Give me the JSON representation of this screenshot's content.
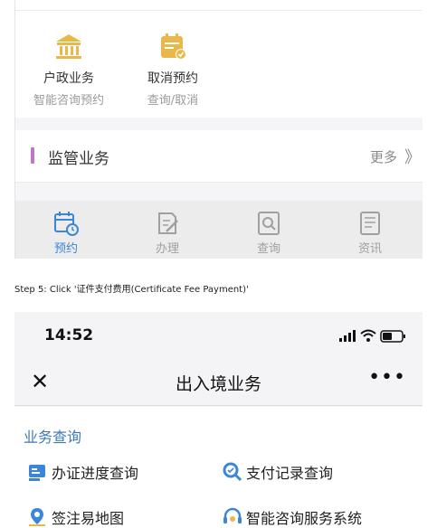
{
  "top_screen": {
    "services": [
      {
        "title": "户政业务",
        "subtitle": "智能咨询预约",
        "icon": "bank-icon"
      },
      {
        "title": "取消预约",
        "subtitle": "查询/取消",
        "icon": "calendar-check-icon"
      }
    ],
    "section": {
      "title": "监管业务",
      "more": "更多",
      "more_chevron": "》"
    },
    "tabs": [
      {
        "label": "预约",
        "icon": "calendar-clock-icon",
        "active": true
      },
      {
        "label": "办理",
        "icon": "edit-doc-icon",
        "active": false
      },
      {
        "label": "查询",
        "icon": "search-doc-icon",
        "active": false
      },
      {
        "label": "资讯",
        "icon": "news-icon",
        "active": false
      }
    ]
  },
  "step_caption": "Step 5: Click '证件支付费用(Certificate Fee Payment)'",
  "bottom_screen": {
    "status_bar": {
      "time": "14:52"
    },
    "nav": {
      "title": "出入境业务",
      "close_icon": "close-icon",
      "more_icon": "more-dots-icon",
      "close_glyph": "✕",
      "more_glyph": "•••"
    },
    "section_title": "业务查询",
    "items": [
      {
        "label": "办证进度查询",
        "icon": "id-card-icon"
      },
      {
        "label": "支付记录查询",
        "icon": "search-icon"
      },
      {
        "label": "签注易地图",
        "icon": "map-pin-icon"
      },
      {
        "label": "智能咨询服务系统",
        "icon": "headset-icon"
      }
    ]
  },
  "colors": {
    "accent_blue": "#3b86d8",
    "section_purple": "#c573c9",
    "gold": "#e8b94a",
    "title_blue": "#3d79b8"
  }
}
